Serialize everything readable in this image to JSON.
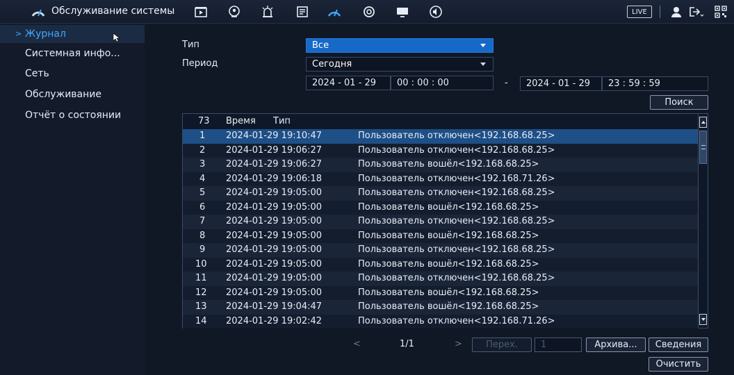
{
  "header": {
    "title": "Обслуживание системы",
    "live_label": "LIVE",
    "icons": [
      "dashboard-gauge-icon",
      "playback-icon",
      "ai-face-icon",
      "alarm-icon",
      "storage-icon",
      "maintenance-gauge-icon",
      "network-icon",
      "display-icon",
      "audio-icon",
      "user-icon",
      "logout-icon",
      "qr-code-icon"
    ],
    "accent_color": "#3fa9ff"
  },
  "sidebar": {
    "items": [
      {
        "label": "Журнал",
        "active": true
      },
      {
        "label": "Системная инфо..."
      },
      {
        "label": "Сеть"
      },
      {
        "label": "Обслуживание"
      },
      {
        "label": "Отчёт о состоянии"
      }
    ]
  },
  "filters": {
    "type_label": "Тип",
    "type_value": "Все",
    "period_label": "Период",
    "period_value": "Сегодня",
    "start_date": "2024 - 01 - 29",
    "start_time": "00 : 00 : 00",
    "range_sep": "-",
    "end_date": "2024 - 01 - 29",
    "end_time": "23 : 59 : 59",
    "search_label": "Поиск"
  },
  "table": {
    "count": "73",
    "col_time": "Время",
    "col_type": "Тип",
    "rows": [
      {
        "n": "1",
        "time": "2024-01-29 19:10:47",
        "event": "Пользователь отключен<192.168.68.25>"
      },
      {
        "n": "2",
        "time": "2024-01-29 19:06:27",
        "event": "Пользователь отключен<192.168.68.25>"
      },
      {
        "n": "3",
        "time": "2024-01-29 19:06:27",
        "event": "Пользователь вошёл<192.168.68.25>"
      },
      {
        "n": "4",
        "time": "2024-01-29 19:06:18",
        "event": "Пользователь отключен<192.168.71.26>"
      },
      {
        "n": "5",
        "time": "2024-01-29 19:05:00",
        "event": "Пользователь отключен<192.168.68.25>"
      },
      {
        "n": "6",
        "time": "2024-01-29 19:05:00",
        "event": "Пользователь вошёл<192.168.68.25>"
      },
      {
        "n": "7",
        "time": "2024-01-29 19:05:00",
        "event": "Пользователь отключен<192.168.68.25>"
      },
      {
        "n": "8",
        "time": "2024-01-29 19:05:00",
        "event": "Пользователь вошёл<192.168.68.25>"
      },
      {
        "n": "9",
        "time": "2024-01-29 19:05:00",
        "event": "Пользователь отключен<192.168.68.25>"
      },
      {
        "n": "10",
        "time": "2024-01-29 19:05:00",
        "event": "Пользователь вошёл<192.168.68.25>"
      },
      {
        "n": "11",
        "time": "2024-01-29 19:05:00",
        "event": "Пользователь отключен<192.168.68.25>"
      },
      {
        "n": "12",
        "time": "2024-01-29 19:05:00",
        "event": "Пользователь вошёл<192.168.68.25>"
      },
      {
        "n": "13",
        "time": "2024-01-29 19:04:47",
        "event": "Пользователь вошёл<192.168.68.25>"
      },
      {
        "n": "14",
        "time": "2024-01-29 19:02:42",
        "event": "Пользователь отключен<192.168.71.26>"
      }
    ]
  },
  "pager": {
    "prev": "<",
    "page": "1/1",
    "next": ">",
    "goto_label": "Перех.",
    "goto_value": "1",
    "archive_label": "Архива...",
    "details_label": "Сведения",
    "clear_label": "Очистить"
  }
}
